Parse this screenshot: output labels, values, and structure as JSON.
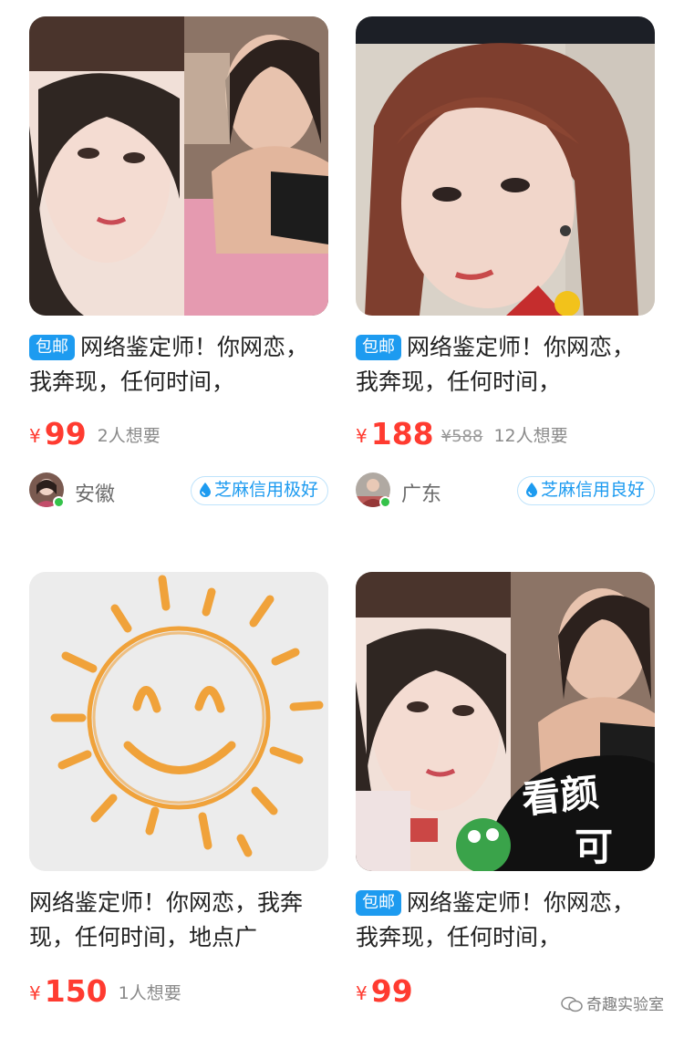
{
  "products": [
    {
      "image": "photo-collage-two-women",
      "tag": "包邮",
      "title": "网络鉴定师！你网恋，我奔现，任何时间，",
      "currency": "¥",
      "price": "99",
      "original_price": "",
      "want": "2人想要",
      "region": "安徽",
      "credit": "芝麻信用极好"
    },
    {
      "image": "photo-portrait-woman",
      "tag": "包邮",
      "title": "网络鉴定师！你网恋，我奔现，任何时间，",
      "currency": "¥",
      "price": "188",
      "original_price": "¥588",
      "want": "12人想要",
      "region": "广东",
      "credit": "芝麻信用良好"
    },
    {
      "image": "sun-smiley-illustration",
      "tag": "",
      "title": "网络鉴定师！你网恋，我奔现，任何时间，地点广",
      "currency": "¥",
      "price": "150",
      "original_price": "",
      "want": "1人想要",
      "region": "",
      "credit": ""
    },
    {
      "image": "photo-collage-sticker",
      "tag": "包邮",
      "title": "网络鉴定师！你网恋，我奔现，任何时间，",
      "currency": "¥",
      "price": "99",
      "original_price": "",
      "want": "",
      "region": "",
      "credit": "",
      "sticker_text": "看颜",
      "sticker_text_2": "可"
    }
  ],
  "watermark": "奇趣实验室",
  "colors": {
    "price": "#ff3b30",
    "tag_bg": "#1d9bf0",
    "credit": "#1d9bf0",
    "online": "#35c24a"
  }
}
